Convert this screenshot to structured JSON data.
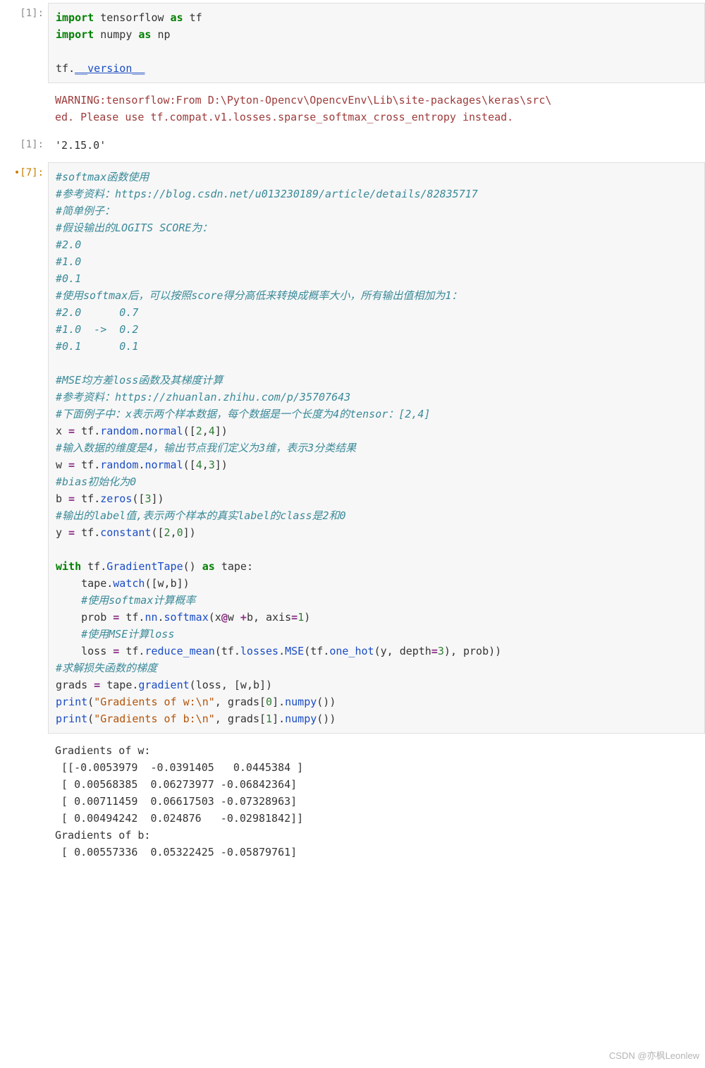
{
  "cells": {
    "c1": {
      "prompt": "[1]:",
      "code": {
        "l1_import": "import ",
        "l1_mod": "tensorflow",
        "l1_as": " as ",
        "l1_alias": "tf",
        "l2_import": "import ",
        "l2_mod": "numpy",
        "l2_as": " as ",
        "l2_alias": "np",
        "l4_obj": "tf",
        "l4_dot": ".",
        "l4_attr": "__version__"
      }
    },
    "c1out": {
      "prompt": "",
      "warn1": "WARNING:tensorflow:From D:\\Pyton-Opencv\\OpencvEnv\\Lib\\site-packages\\keras\\src\\",
      "warn2": "ed. Please use tf.compat.v1.losses.sparse_softmax_cross_entropy instead."
    },
    "c1res": {
      "prompt": "[1]:",
      "value": "'2.15.0'"
    },
    "c7": {
      "prompt": "[7]:",
      "modmark": "•",
      "code": {
        "cm01": "#softmax函数使用",
        "cm02": "#参考资料：https://blog.csdn.net/u013230189/article/details/82835717",
        "cm03": "#简单例子：",
        "cm04": "#假设输出的LOGITS SCORE为：",
        "cm05": "#2.0",
        "cm06": "#1.0",
        "cm07": "#0.1",
        "cm08": "#使用softmax后，可以按照score得分高低来转换成概率大小，所有输出值相加为1：",
        "cm09": "#2.0      0.7",
        "cm10": "#1.0  ->  0.2",
        "cm11": "#0.1      0.1",
        "cm13": "#MSE均方差loss函数及其梯度计算",
        "cm14": "#参考资料：https://zhuanlan.zhihu.com/p/35707643",
        "cm15": "#下面例子中：x表示两个样本数据，每个数据是一个长度为4的tensor：[2,4]",
        "l16": {
          "x": "x",
          "eq": " = ",
          "t": "tf",
          "d1": ".",
          "rand": "random",
          "d2": ".",
          "norm": "normal",
          "p": "([",
          "n1": "2",
          "c": ",",
          "n2": "4",
          "pe": "])"
        },
        "cm17": "#输入数据的维度是4，输出节点我们定义为3维，表示3分类结果",
        "l18": {
          "w": "w",
          "eq": " = ",
          "t": "tf",
          "d1": ".",
          "rand": "random",
          "d2": ".",
          "norm": "normal",
          "p": "([",
          "n1": "4",
          "c": ",",
          "n2": "3",
          "pe": "])"
        },
        "cm19": "#bias初始化为0",
        "l20": {
          "b": "b",
          "eq": " = ",
          "t": "tf",
          "d": ".",
          "zeros": "zeros",
          "p": "([",
          "n": "3",
          "pe": "])"
        },
        "cm21": "#输出的label值,表示两个样本的真实label的class是2和0",
        "l22": {
          "y": "y",
          "eq": " = ",
          "t": "tf",
          "d": ".",
          "const": "constant",
          "p": "([",
          "n1": "2",
          "c": ",",
          "n2": "0",
          "pe": "])"
        },
        "l24": {
          "with": "with ",
          "t": "tf",
          "d": ".",
          "gt": "GradientTape",
          "par": "()",
          "as": " as ",
          "tape": "tape",
          "col": ":"
        },
        "l25": {
          "ind": "    ",
          "tape": "tape",
          "d": ".",
          "watch": "watch",
          "p": "([",
          "w": "w",
          "c": ",",
          "b": "b",
          "pe": "])"
        },
        "cm26": "    #使用softmax计算概率",
        "l27": {
          "ind": "    ",
          "prob": "prob",
          "eq": " = ",
          "t": "tf",
          "d1": ".",
          "nn": "nn",
          "d2": ".",
          "sm": "softmax",
          "p": "(",
          "x": "x",
          "at": "@",
          "w": "w",
          "sp": " ",
          "plus": "+",
          "b": "b",
          "c": ", ",
          "axis": "axis",
          "eq2": "=",
          "n": "1",
          "pe": ")"
        },
        "cm28": "    #使用MSE计算loss",
        "l29": {
          "ind": "    ",
          "loss": "loss",
          "eq": " = ",
          "t": "tf",
          "d1": ".",
          "rm": "reduce_mean",
          "p": "(",
          "t2": "tf",
          "d2": ".",
          "ls": "losses",
          "d3": ".",
          "mse": "MSE",
          "p2": "(",
          "t3": "tf",
          "d4": ".",
          "oh": "one_hot",
          "p3": "(",
          "y": "y",
          "c": ", ",
          "dep": "depth",
          "eq2": "=",
          "n": "3",
          "pe": ")",
          ", ": "",
          "c2": ", ",
          "pr": "prob",
          "pe2": "))"
        },
        "cm30": "#求解损失函数的梯度",
        "l31": {
          "g": "grads",
          "eq": " = ",
          "tape": "tape",
          "d": ".",
          "grad": "gradient",
          "p": "(",
          "loss": "loss",
          "c": ", [",
          "w": "w",
          "c2": ",",
          "b": "b",
          "pe": "])"
        },
        "l32": {
          "print": "print",
          "p": "(",
          "s": "\"Gradients of w:\\n\"",
          "c": ", ",
          "g": "grads",
          "b": "[",
          "n": "0",
          "be": "]",
          "d": ".",
          "np": "numpy",
          "pe": "())"
        },
        "l33": {
          "print": "print",
          "p": "(",
          "s": "\"Gradients of b:\\n\"",
          "c": ", ",
          "g": "grads",
          "b": "[",
          "n": "1",
          "be": "]",
          "d": ".",
          "np": "numpy",
          "pe": "())"
        }
      }
    },
    "c7out": {
      "l1": "Gradients of w:",
      "l2": " [[-0.0053979  -0.0391405   0.0445384 ]",
      "l3": " [ 0.00568385  0.06273977 -0.06842364]",
      "l4": " [ 0.00711459  0.06617503 -0.07328963]",
      "l5": " [ 0.00494242  0.024876   -0.02981842]]",
      "l6": "Gradients of b:",
      "l7": " [ 0.00557336  0.05322425 -0.05879761]"
    }
  },
  "watermark": "CSDN @亦枫Leonlew"
}
